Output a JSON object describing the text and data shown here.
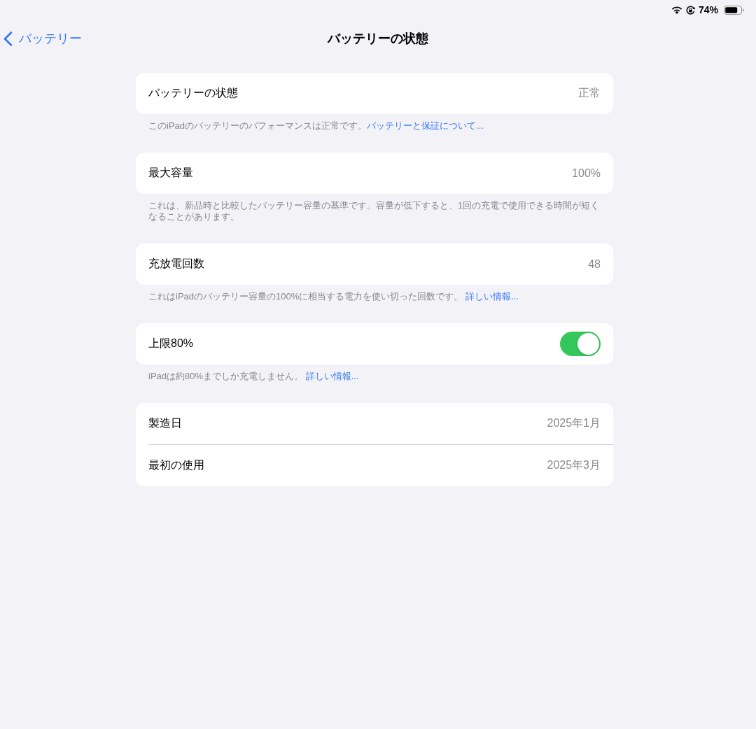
{
  "status_bar": {
    "battery_percent": "74%"
  },
  "nav": {
    "back_label": "バッテリー",
    "title": "バッテリーの状態"
  },
  "sections": [
    {
      "rows": [
        {
          "kind": "value",
          "label": "バッテリーの状態",
          "value": "正常"
        }
      ],
      "footer": {
        "text": "このiPadのバッテリーのパフォーマンスは正常です。",
        "link": "バッテリーと保証について..."
      }
    },
    {
      "rows": [
        {
          "kind": "value",
          "label": "最大容量",
          "value": "100%"
        }
      ],
      "footer": {
        "text": "これは、新品時と比較したバッテリー容量の基準です。容量が低下すると、1回の充電で使用できる時間が短くなることがあります。"
      }
    },
    {
      "rows": [
        {
          "kind": "value",
          "label": "充放電回数",
          "value": "48"
        }
      ],
      "footer": {
        "text": "これはiPadのバッテリー容量の100%に相当する電力を使い切った回数です。 ",
        "link": "詳しい情報..."
      }
    },
    {
      "rows": [
        {
          "kind": "toggle",
          "label": "上限80%",
          "on": true
        }
      ],
      "footer": {
        "text": "iPadは約80%までしか充電しません。 ",
        "link": "詳しい情報..."
      }
    },
    {
      "rows": [
        {
          "kind": "value",
          "label": "製造日",
          "value": "2025年1月"
        },
        {
          "kind": "value",
          "label": "最初の使用",
          "value": "2025年3月"
        }
      ]
    }
  ]
}
